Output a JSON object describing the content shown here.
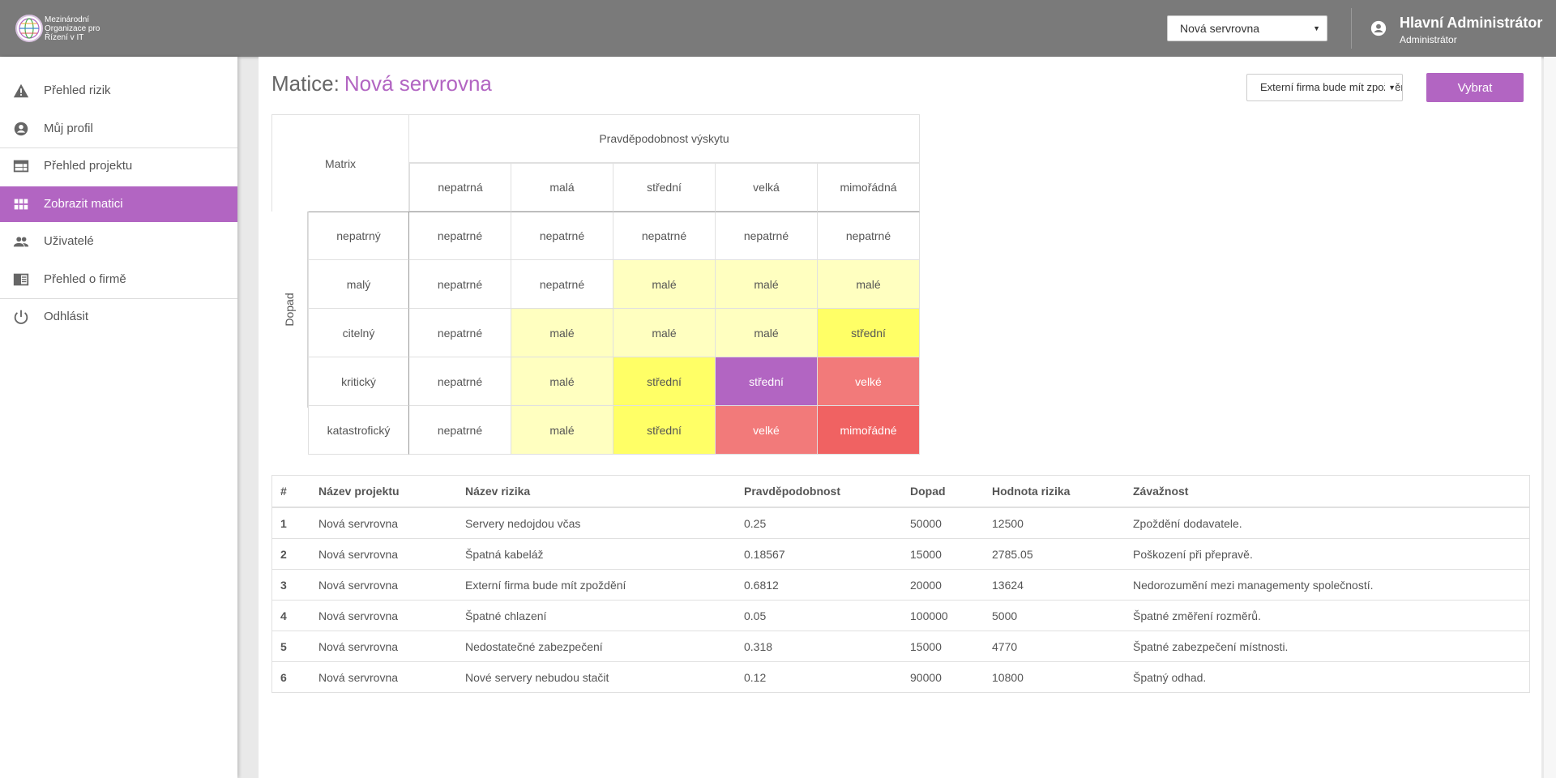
{
  "header": {
    "org_name": "Mezinárodní Organizace pro Řízení v IT",
    "org_line1": "Mezinárodní",
    "org_line2": "Organizace pro",
    "org_line3": "Řízení v IT",
    "project_select_value": "Nová servrovna",
    "user_name": "Hlavní Administrátor",
    "user_role": "Administrátor"
  },
  "sidebar": {
    "items": [
      {
        "label": "Přehled rizik",
        "icon": "warning-icon"
      },
      {
        "label": "Můj profil",
        "icon": "account-circle-icon"
      },
      {
        "label": "Přehled projektu",
        "icon": "web-icon"
      },
      {
        "label": "Zobrazit matici",
        "icon": "grid-icon"
      },
      {
        "label": "Uživatelé",
        "icon": "people-icon"
      },
      {
        "label": "Přehled o firmě",
        "icon": "chrome-reader-icon"
      },
      {
        "label": "Odhlásit",
        "icon": "power-icon"
      }
    ]
  },
  "main": {
    "title_prefix": "Matice:",
    "title_project": "Nová servrovna",
    "risk_select_value": "Externí firma bude mít zpoždění",
    "select_button": "Vybrat"
  },
  "matrix": {
    "corner": "Matrix",
    "probability_header": "Pravděpodobnost výskytu",
    "impact_header": "Dopad",
    "columns": [
      "nepatrná",
      "malá",
      "střední",
      "velká",
      "mimořádná"
    ],
    "rows": [
      {
        "label": "nepatrný",
        "cells": [
          "nepatrné",
          "nepatrné",
          "nepatrné",
          "nepatrné",
          "nepatrné"
        ]
      },
      {
        "label": "malý",
        "cells": [
          "nepatrné",
          "nepatrné",
          "malé",
          "malé",
          "malé"
        ]
      },
      {
        "label": "citelný",
        "cells": [
          "nepatrné",
          "malé",
          "malé",
          "malé",
          "střední"
        ]
      },
      {
        "label": "kritický",
        "cells": [
          "nepatrné",
          "malé",
          "střední",
          "střední",
          "velké"
        ]
      },
      {
        "label": "katastrofický",
        "cells": [
          "nepatrné",
          "malé",
          "střední",
          "velké",
          "mimořádné"
        ]
      }
    ],
    "selected_cell": {
      "row": 3,
      "col": 3
    },
    "level_colors": {
      "nepatrné": "#ffffff",
      "malé": "#ffffc0",
      "střední": "#ffff66",
      "velké": "#f27a7a",
      "mimořádné": "#f06262",
      "selected": "#b265c2"
    }
  },
  "table": {
    "headers": [
      "#",
      "Název projektu",
      "Název rizika",
      "Pravděpodobnost",
      "Dopad",
      "Hodnota rizika",
      "Závažnost"
    ],
    "rows": [
      [
        "1",
        "Nová servrovna",
        "Servery nedojdou včas",
        "0.25",
        "50000",
        "12500",
        "Zpoždění dodavatele."
      ],
      [
        "2",
        "Nová servrovna",
        "Špatná kabeláž",
        "0.18567",
        "15000",
        "2785.05",
        "Poškození při přepravě."
      ],
      [
        "3",
        "Nová servrovna",
        "Externí firma bude mít zpoždění",
        "0.6812",
        "20000",
        "13624",
        "Nedorozumění mezi managementy společností."
      ],
      [
        "4",
        "Nová servrovna",
        "Špatné chlazení",
        "0.05",
        "100000",
        "5000",
        "Špatné změření rozměrů."
      ],
      [
        "5",
        "Nová servrovna",
        "Nedostatečné zabezpečení",
        "0.318",
        "15000",
        "4770",
        "Špatné zabezpečení místnosti."
      ],
      [
        "6",
        "Nová servrovna",
        "Nové servery nebudou stačit",
        "0.12",
        "90000",
        "10800",
        "Špatný odhad."
      ]
    ]
  }
}
